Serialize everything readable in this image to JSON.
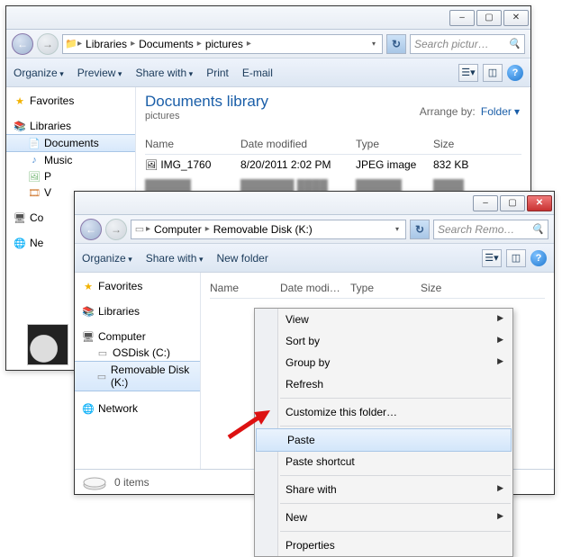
{
  "window1": {
    "breadcrumbs": [
      "Libraries",
      "Documents",
      "pictures"
    ],
    "search_placeholder": "Search pictur…",
    "toolbar": {
      "organize": "Organize",
      "preview": "Preview",
      "share_with": "Share with",
      "print": "Print",
      "email": "E-mail"
    },
    "lib_title": "Documents library",
    "lib_sub": "pictures",
    "arrange_by_label": "Arrange by:",
    "arrange_by_value": "Folder",
    "columns": {
      "name": "Name",
      "date": "Date modified",
      "type": "Type",
      "size": "Size"
    },
    "rows": [
      {
        "name": "IMG_1760",
        "date": "8/20/2011 2:02 PM",
        "type": "JPEG image",
        "size": "832 KB"
      }
    ],
    "sidebar": {
      "favorites": "Favorites",
      "libraries": "Libraries",
      "documents": "Documents",
      "music": "Music",
      "pictures": "P",
      "videos": "V",
      "computer": "Co",
      "network": "Ne"
    }
  },
  "window2": {
    "breadcrumbs": [
      "Computer",
      "Removable Disk (K:)"
    ],
    "search_placeholder": "Search Remo…",
    "toolbar": {
      "organize": "Organize",
      "share_with": "Share with",
      "new_folder": "New folder"
    },
    "columns": {
      "name": "Name",
      "date": "Date modi…",
      "type": "Type",
      "size": "Size"
    },
    "sidebar": {
      "favorites": "Favorites",
      "libraries": "Libraries",
      "computer": "Computer",
      "osdisk": "OSDisk (C:)",
      "removable": "Removable Disk (K:)",
      "network": "Network"
    },
    "status": "0 items"
  },
  "context_menu": {
    "view": "View",
    "sort_by": "Sort by",
    "group_by": "Group by",
    "refresh": "Refresh",
    "customize": "Customize this folder…",
    "paste": "Paste",
    "paste_shortcut": "Paste shortcut",
    "share_with": "Share with",
    "new": "New",
    "properties": "Properties"
  }
}
